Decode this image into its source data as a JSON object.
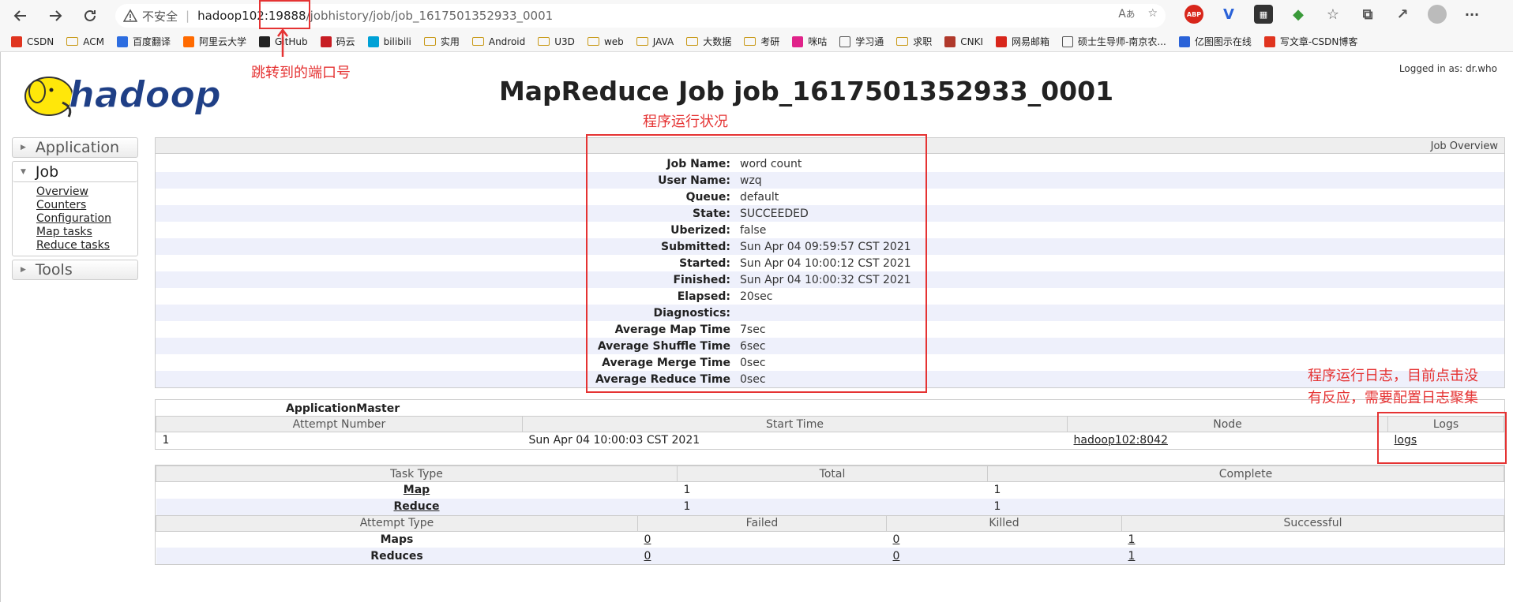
{
  "browser": {
    "security_label": "不安全",
    "url_host": "hadoop102",
    "url_port": ":19888",
    "url_path": "/jobhistory/job/job_1617501352933_0001",
    "addr_right_icons": [
      "read-aloud-icon",
      "favorite-icon"
    ],
    "toolbar_icons": [
      "abp-icon",
      "extension-v-icon",
      "extension-box-icon",
      "extension-green-icon",
      "favorites-icon",
      "collections-icon",
      "share-icon",
      "profile-icon",
      "more-icon"
    ],
    "more_label": "···"
  },
  "bookmarks": [
    {
      "label": "CSDN",
      "icon": "csdn-icon",
      "color": "#e0341f"
    },
    {
      "label": "ACM",
      "icon": "folder-icon"
    },
    {
      "label": "百度翻译",
      "icon": "baidu-translate-icon",
      "color": "#2d6de0"
    },
    {
      "label": "阿里云大学",
      "icon": "aliyun-icon",
      "color": "#ff6a00"
    },
    {
      "label": "GitHub",
      "icon": "github-icon",
      "color": "#222222"
    },
    {
      "label": "码云",
      "icon": "gitee-icon",
      "color": "#c71d23"
    },
    {
      "label": "bilibili",
      "icon": "bilibili-icon",
      "color": "#00a1d6"
    },
    {
      "label": "实用",
      "icon": "folder-icon"
    },
    {
      "label": "Android",
      "icon": "folder-icon"
    },
    {
      "label": "U3D",
      "icon": "folder-icon"
    },
    {
      "label": "web",
      "icon": "folder-icon"
    },
    {
      "label": "JAVA",
      "icon": "folder-icon"
    },
    {
      "label": "大数据",
      "icon": "folder-icon"
    },
    {
      "label": "考研",
      "icon": "folder-icon"
    },
    {
      "label": "咪咕",
      "icon": "migu-icon",
      "color": "#e0238a"
    },
    {
      "label": "学习通",
      "icon": "page-icon"
    },
    {
      "label": "求职",
      "icon": "folder-icon"
    },
    {
      "label": "CNKI",
      "icon": "cnki-icon",
      "color": "#b0392b"
    },
    {
      "label": "网易邮箱",
      "icon": "netease-mail-icon",
      "color": "#d8261b"
    },
    {
      "label": "硕士生导师-南京农...",
      "icon": "page-icon"
    },
    {
      "label": "亿图图示在线",
      "icon": "edraw-icon",
      "color": "#2a62d8"
    },
    {
      "label": "写文章-CSDN博客",
      "icon": "csdn-icon",
      "color": "#e0341f"
    }
  ],
  "page": {
    "logo_text": "hadoop",
    "logged_in": "Logged in as: dr.who",
    "title": "MapReduce Job job_1617501352933_0001"
  },
  "sidebar": {
    "application": "Application",
    "job": "Job",
    "job_links": [
      "Overview",
      "Counters",
      "Configuration",
      "Map tasks",
      "Reduce tasks"
    ],
    "tools": "Tools"
  },
  "overview": {
    "header": "Job Overview",
    "rows": [
      {
        "key": "Job Name:",
        "value": "word count"
      },
      {
        "key": "User Name:",
        "value": "wzq"
      },
      {
        "key": "Queue:",
        "value": "default"
      },
      {
        "key": "State:",
        "value": "SUCCEEDED"
      },
      {
        "key": "Uberized:",
        "value": "false"
      },
      {
        "key": "Submitted:",
        "value": "Sun Apr 04 09:59:57 CST 2021"
      },
      {
        "key": "Started:",
        "value": "Sun Apr 04 10:00:12 CST 2021"
      },
      {
        "key": "Finished:",
        "value": "Sun Apr 04 10:00:32 CST 2021"
      },
      {
        "key": "Elapsed:",
        "value": "20sec"
      },
      {
        "key": "Diagnostics:",
        "value": ""
      },
      {
        "key": "Average Map Time",
        "value": "7sec"
      },
      {
        "key": "Average Shuffle Time",
        "value": "6sec"
      },
      {
        "key": "Average Merge Time",
        "value": "0sec"
      },
      {
        "key": "Average Reduce Time",
        "value": "0sec"
      }
    ]
  },
  "app_master": {
    "title": "ApplicationMaster",
    "headers": [
      "Attempt Number",
      "Start Time",
      "Node",
      "Logs"
    ],
    "row": {
      "attempt": "1",
      "start_time": "Sun Apr 04 10:00:03 CST 2021",
      "node": "hadoop102:8042",
      "logs": "logs"
    }
  },
  "tasks": {
    "headers": [
      "Task Type",
      "Total",
      "Complete"
    ],
    "rows": [
      {
        "type": "Map",
        "total": "1",
        "complete": "1"
      },
      {
        "type": "Reduce",
        "total": "1",
        "complete": "1"
      }
    ],
    "attempt_headers": [
      "Attempt Type",
      "Failed",
      "Killed",
      "Successful"
    ],
    "attempt_rows": [
      {
        "type": "Maps",
        "failed": "0",
        "killed": "0",
        "successful": "1"
      },
      {
        "type": "Reduces",
        "failed": "0",
        "killed": "0",
        "successful": "1"
      }
    ]
  },
  "annotations": {
    "port_note": "跳转到的端口号",
    "status_note": "程序运行状况",
    "log_note_line1": "程序运行日志，目前点击没",
    "log_note_line2": "有反应，需要配置日志聚集",
    "color": "#e53333"
  }
}
